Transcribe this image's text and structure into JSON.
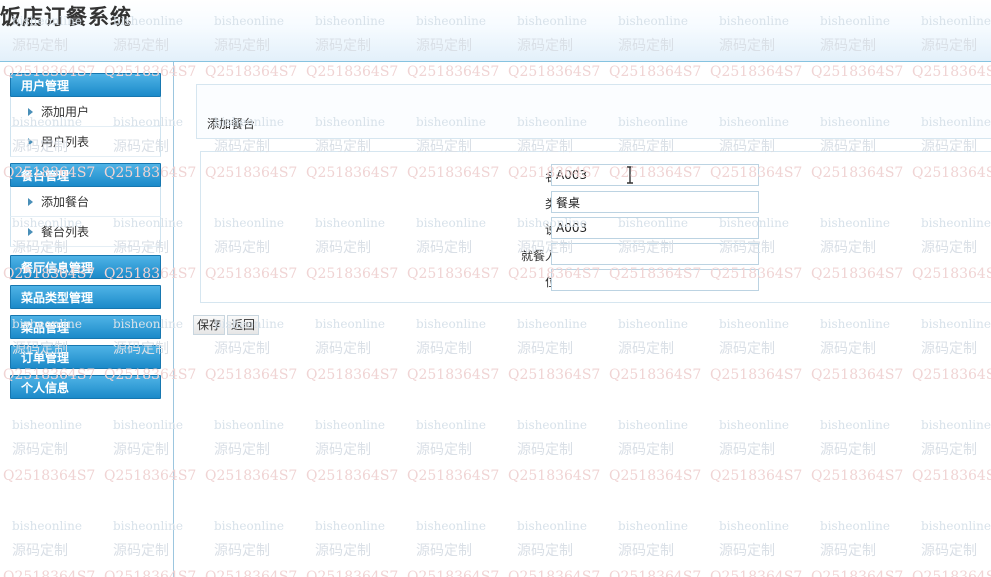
{
  "app": {
    "title": "饭店订餐系统"
  },
  "sidebar": {
    "groups": [
      {
        "label": "用户管理",
        "items": [
          "添加用户",
          "用户列表"
        ]
      },
      {
        "label": "餐台管理",
        "items": [
          "添加餐台",
          "餐台列表"
        ]
      },
      {
        "label": "餐厅信息管理",
        "items": []
      },
      {
        "label": "菜品类型管理",
        "items": []
      },
      {
        "label": "菜品管理",
        "items": []
      },
      {
        "label": "订单管理",
        "items": []
      },
      {
        "label": "个人信息",
        "items": []
      }
    ]
  },
  "page": {
    "heading": "添加餐台"
  },
  "form": {
    "fields": [
      {
        "label": "名称",
        "value": "A003"
      },
      {
        "label": "类型",
        "value": "餐桌"
      },
      {
        "label": "说明",
        "value": "A003"
      },
      {
        "label": "就餐人数",
        "value": ""
      },
      {
        "label": "位置",
        "value": ""
      }
    ]
  },
  "buttons": {
    "save": "保存",
    "back": "返回"
  },
  "watermark": {
    "line1": "bisheonline",
    "line2": "源码定制",
    "line3": "Q2518364S7"
  },
  "colors": {
    "accent": "#1b8ac9",
    "header_border": "#86c3e0"
  }
}
